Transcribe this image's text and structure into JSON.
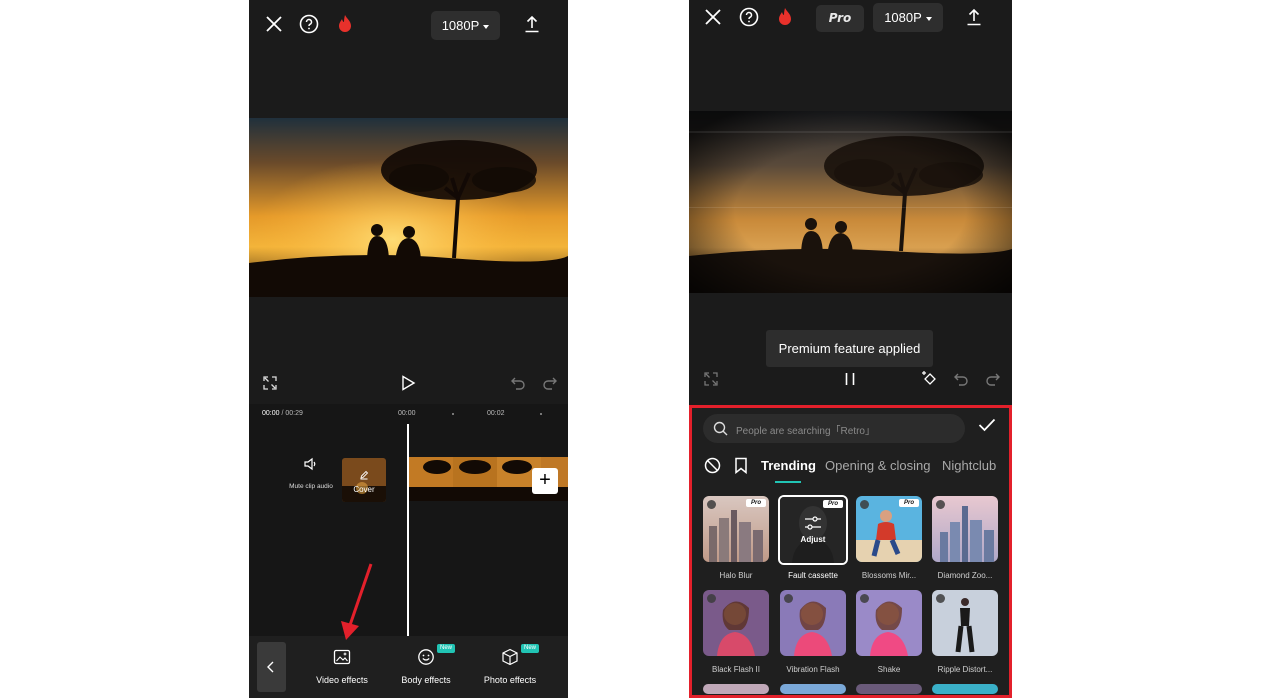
{
  "left": {
    "resolution": "1080P",
    "timeline": {
      "current_time": "00:00",
      "total_time": "/ 00:29",
      "tick_0": "00:00",
      "tick_2": "00:02",
      "mute_label": "Mute clip audio",
      "cover_label": "Cover"
    },
    "toolbar": [
      {
        "label": "Video effects",
        "icon": "video-effects-icon",
        "badge": ""
      },
      {
        "label": "Body effects",
        "icon": "face-smile-icon",
        "badge": "New"
      },
      {
        "label": "Photo effects",
        "icon": "cube-icon",
        "badge": "New"
      }
    ]
  },
  "right": {
    "resolution": "1080P",
    "pro_label": "Pro",
    "toast": "Premium feature applied",
    "search_placeholder": "People are searching「Retro」",
    "tabs": [
      "Trending",
      "Opening & closing",
      "Nightclub"
    ],
    "active_tab": "Trending",
    "effects": [
      {
        "name": "Halo Blur",
        "pro": true
      },
      {
        "name": "Fault cassette",
        "pro": true,
        "selected": true,
        "overlay": "Adjust"
      },
      {
        "name": "Blossoms Mir...",
        "pro": true
      },
      {
        "name": "Diamond Zoo...",
        "pro": false
      },
      {
        "name": "Black Flash II",
        "pro": false
      },
      {
        "name": "Vibration Flash",
        "pro": false
      },
      {
        "name": "Shake",
        "pro": false
      },
      {
        "name": "Ripple Distort...",
        "pro": false
      }
    ],
    "pro_badge": "Pro"
  },
  "colors": {
    "accent": "#21c4b4",
    "highlight_border": "#e3202b",
    "annotation_arrow": "#e3202b",
    "flame": "#e8312b"
  }
}
